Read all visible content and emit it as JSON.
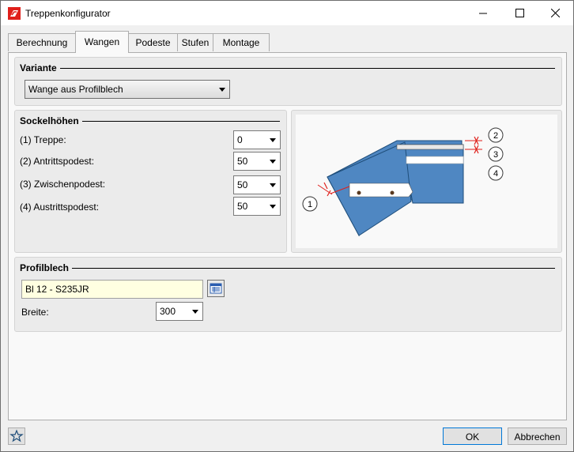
{
  "window": {
    "title": "Treppenkonfigurator"
  },
  "tabs": [
    "Berechnung",
    "Wangen",
    "Podeste",
    "Stufen",
    "Montage"
  ],
  "active_tab": "Wangen",
  "variante": {
    "header": "Variante",
    "value": "Wange aus Profilblech"
  },
  "sockel": {
    "header": "Sockelhöhen",
    "rows": [
      {
        "label": "(1) Treppe:",
        "value": "0"
      },
      {
        "label": "(2) Antrittspodest:",
        "value": "50"
      },
      {
        "label": "(3) Zwischenpodest:",
        "value": "50"
      },
      {
        "label": "(4) Austrittspodest:",
        "value": "50"
      }
    ]
  },
  "diagram": {
    "markers": [
      "1",
      "2",
      "3",
      "4"
    ]
  },
  "profilblech": {
    "header": "Profilblech",
    "material": "Bl 12 - S235JR",
    "breite_label": "Breite:",
    "breite_value": "300"
  },
  "buttons": {
    "ok": "OK",
    "cancel": "Abbrechen"
  },
  "colors": {
    "steel_blue": "#4f87c2",
    "material_field": "#ffffe1",
    "accent_red": "#e0201b"
  }
}
